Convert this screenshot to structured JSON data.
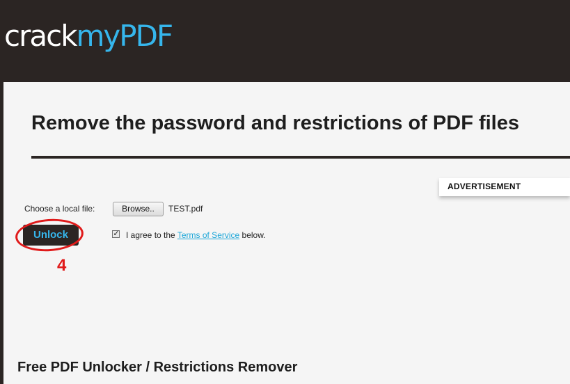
{
  "header": {
    "logo_part1": "crack",
    "logo_part2": "myPDF"
  },
  "main": {
    "page_title": "Remove the password and restrictions of PDF files",
    "advertisement_label": "ADVERTISEMENT",
    "file_chooser": {
      "label": "Choose a local file:",
      "browse_label": "Browse..",
      "file_name": "TEST.pdf"
    },
    "unlock_label": "Unlock",
    "agreement": {
      "checked": true,
      "text_before": "I agree to the ",
      "link_text": "Terms of Service",
      "text_after": " below."
    },
    "section_heading": "Free PDF Unlocker / Restrictions Remover"
  },
  "annotation": {
    "step_number": "4",
    "color": "#e01a1a"
  },
  "colors": {
    "header_bg": "#2b2523",
    "accent_blue": "#36b6ec",
    "link_blue": "#1ba6d8",
    "panel_bg": "#f5f5f5"
  },
  "icons": {
    "checkbox_check": "check-mark-icon"
  }
}
